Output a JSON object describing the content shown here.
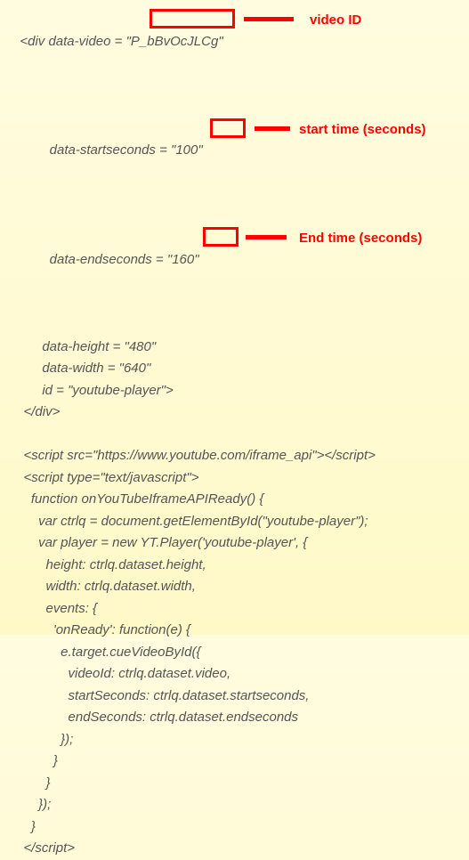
{
  "code": {
    "l1": "<div data-video = \"P_bBvOcJLCg\"",
    "l2": "        data-startseconds = \"100\"",
    "l3": "        data-endseconds = \"160\"",
    "l4": "        data-height = \"480\"",
    "l5": "        data-width = \"640\"",
    "l6": "        id = \"youtube-player\">",
    "l7": "   </div>",
    "l8": " ",
    "l9": "   <script src=\"https://www.youtube.com/iframe_api\"></script>",
    "l10": "   <script type=\"text/javascript\">",
    "l11": "     function onYouTubeIframeAPIReady() {",
    "l12": "       var ctrlq = document.getElementById(\"youtube-player\");",
    "l13": "       var player = new YT.Player('youtube-player', {",
    "l14": "         height: ctrlq.dataset.height,",
    "l15": "         width: ctrlq.dataset.width,",
    "l16": "         events: {",
    "l17": "           'onReady': function(e) {",
    "l18": "             e.target.cueVideoById({",
    "l19": "               videoId: ctrlq.dataset.video,",
    "l20": "               startSeconds: ctrlq.dataset.startseconds,",
    "l21": "               endSeconds: ctrlq.dataset.endseconds",
    "l22": "             });",
    "l23": "           }",
    "l24": "         }",
    "l25": "       });",
    "l26": "     }",
    "l27": "   </script>"
  },
  "annotations": {
    "video_id_label": "video ID",
    "start_time_label": "start time (seconds)",
    "end_time_label": "End time (seconds)"
  }
}
